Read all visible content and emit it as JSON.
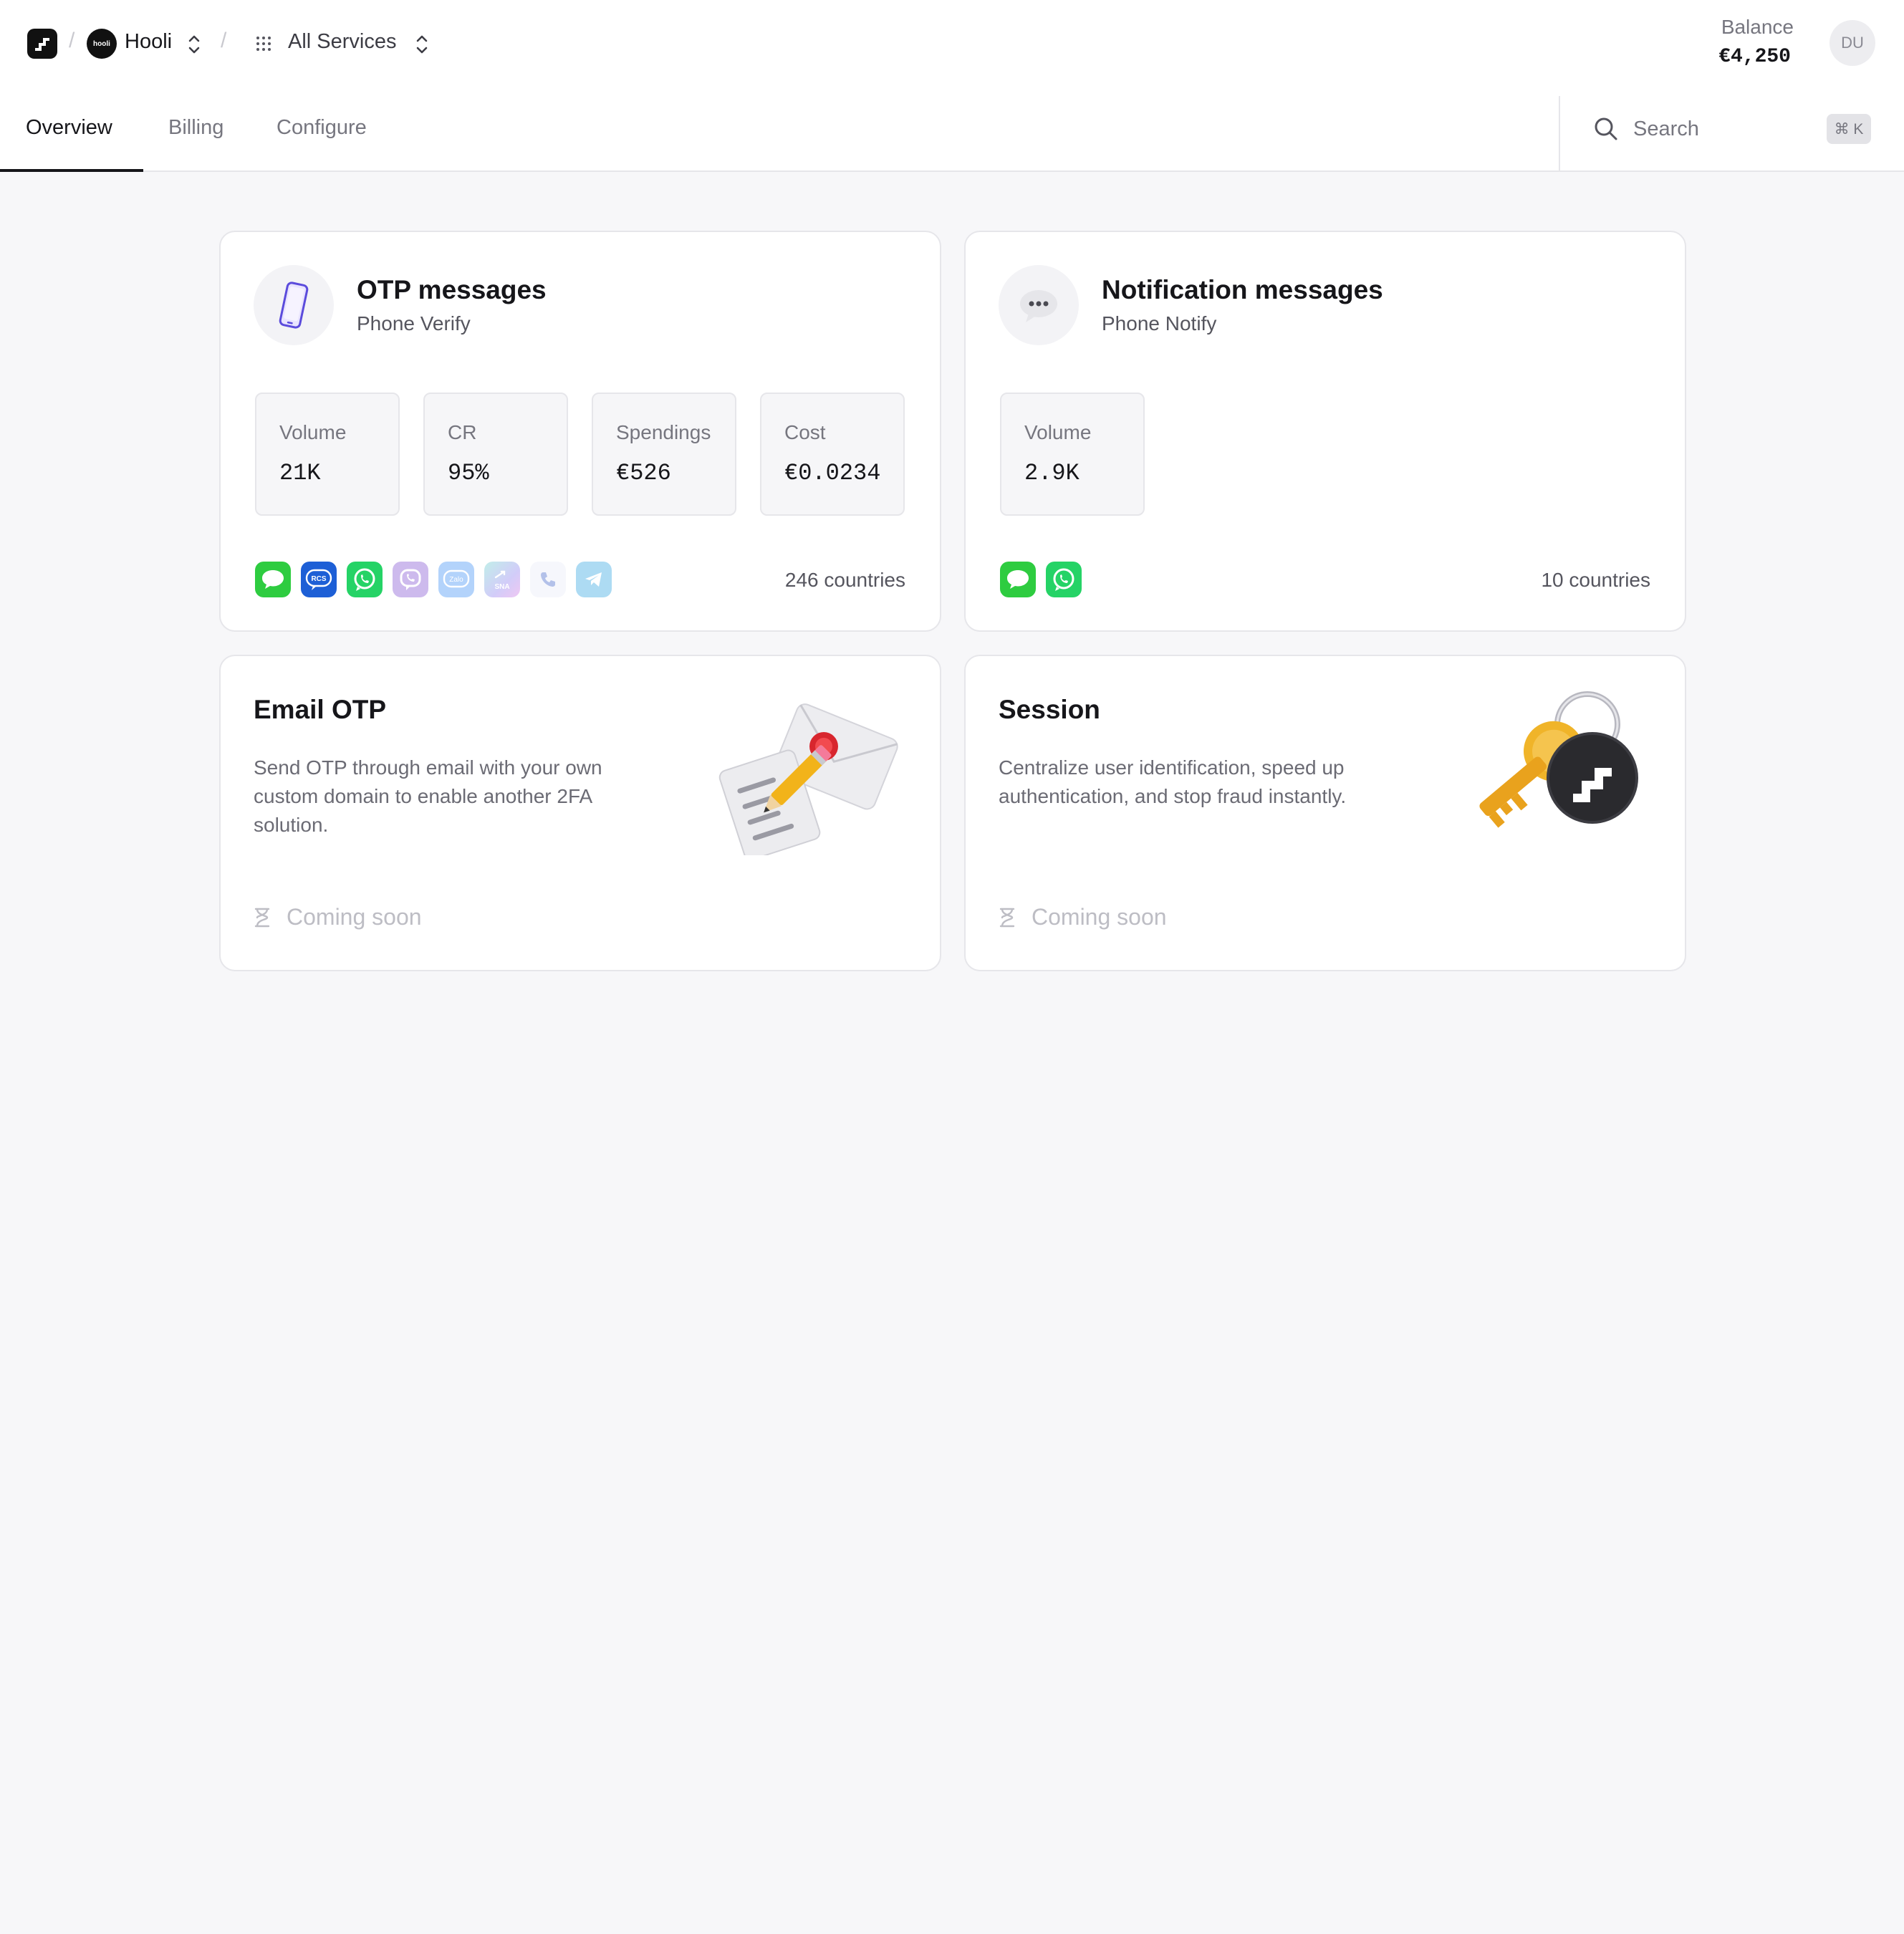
{
  "header": {
    "org_name": "Hooli",
    "org_avatar_text": "hooli",
    "services_label": "All Services",
    "balance_label": "Balance",
    "balance_value": "€4,250",
    "user_initials": "DU"
  },
  "tabs": [
    {
      "label": "Overview",
      "active": true
    },
    {
      "label": "Billing",
      "active": false
    },
    {
      "label": "Configure",
      "active": false
    }
  ],
  "search": {
    "placeholder": "Search",
    "shortcut": "⌘ K"
  },
  "cards": {
    "otp": {
      "title": "OTP messages",
      "subtitle": "Phone Verify",
      "icon": "smartphone-icon",
      "metrics": [
        {
          "label": "Volume",
          "value": "21K"
        },
        {
          "label": "CR",
          "value": "95%"
        },
        {
          "label": "Spendings",
          "value": "€526"
        },
        {
          "label": "Cost",
          "value": "€0.0234"
        }
      ],
      "channels": [
        "sms",
        "rcs",
        "whatsapp",
        "viber",
        "zalo",
        "sna",
        "voice-call",
        "telegram"
      ],
      "countries": "246 countries"
    },
    "notify": {
      "title": "Notification messages",
      "subtitle": "Phone Notify",
      "icon": "speech-bubble-icon",
      "metrics": [
        {
          "label": "Volume",
          "value": "2.9K"
        }
      ],
      "channels": [
        "sms",
        "whatsapp"
      ],
      "countries": "10 countries"
    },
    "email": {
      "title": "Email OTP",
      "description": "Send OTP through email with your own custom domain to enable another 2FA solution.",
      "status": "Coming soon",
      "illustration": "envelope-pencil-icon"
    },
    "session": {
      "title": "Session",
      "description": "Centralize user identification, speed up authentication, and stop fraud instantly.",
      "status": "Coming soon",
      "illustration": "keys-icon"
    }
  },
  "badges": {
    "rcs": "RCS",
    "zalo": "Zalo",
    "sna": "SNA"
  },
  "colors": {
    "accent": "#16161a",
    "sms_green": "#2ecc40",
    "rcs_blue": "#1d5fd6",
    "whatsapp_green": "#25d366",
    "viber_purple": "#7d4bd1",
    "telegram_blue": "#2aa3e0",
    "background": "#f7f7f9"
  }
}
